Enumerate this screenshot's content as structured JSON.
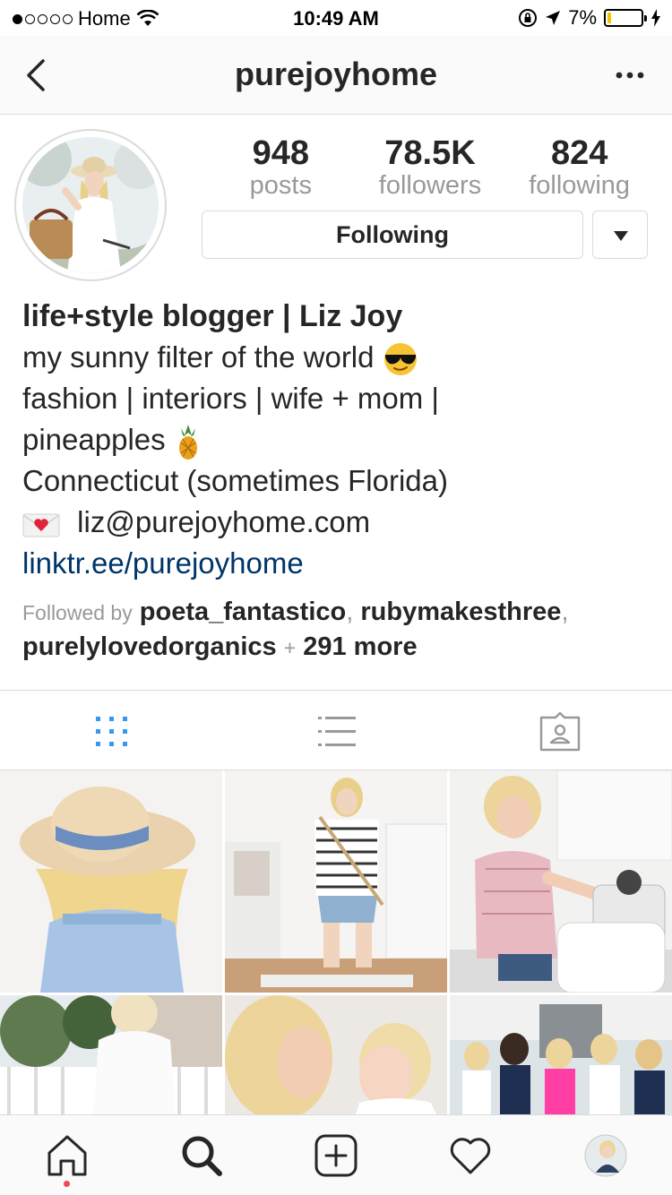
{
  "status_bar": {
    "carrier": "Home",
    "time": "10:49 AM",
    "battery": "7%",
    "battery_level": 0.07
  },
  "nav": {
    "username": "purejoyhome"
  },
  "profile": {
    "stats": [
      {
        "value": "948",
        "label": "posts"
      },
      {
        "value": "78.5K",
        "label": "followers"
      },
      {
        "value": "824",
        "label": "following"
      }
    ],
    "follow_button": "Following"
  },
  "bio": {
    "name": "life+style blogger | Liz Joy",
    "line1": "my sunny filter of the world",
    "line2": "fashion | interiors | wife + mom |",
    "line3": "pineapples",
    "line4": "Connecticut (sometimes Florida)",
    "email": "liz@purejoyhome.com",
    "link": "linktr.ee/purejoyhome"
  },
  "followed_by": {
    "prefix": "Followed by",
    "user1": "poeta_fantastico",
    "user2": "rubymakesthree",
    "user3": "purelylovedorganics",
    "more": "291 more"
  },
  "tabs": [
    "grid-view",
    "list-view",
    "tagged-view"
  ],
  "colors": {
    "accent_blue": "#3897f0",
    "link": "#003569",
    "muted": "#999999",
    "border": "#dbdbdb",
    "notification": "#ed4956"
  },
  "bottom_tabs": [
    "home-icon",
    "search-icon",
    "new-post-icon",
    "activity-heart-icon",
    "profile-avatar"
  ]
}
